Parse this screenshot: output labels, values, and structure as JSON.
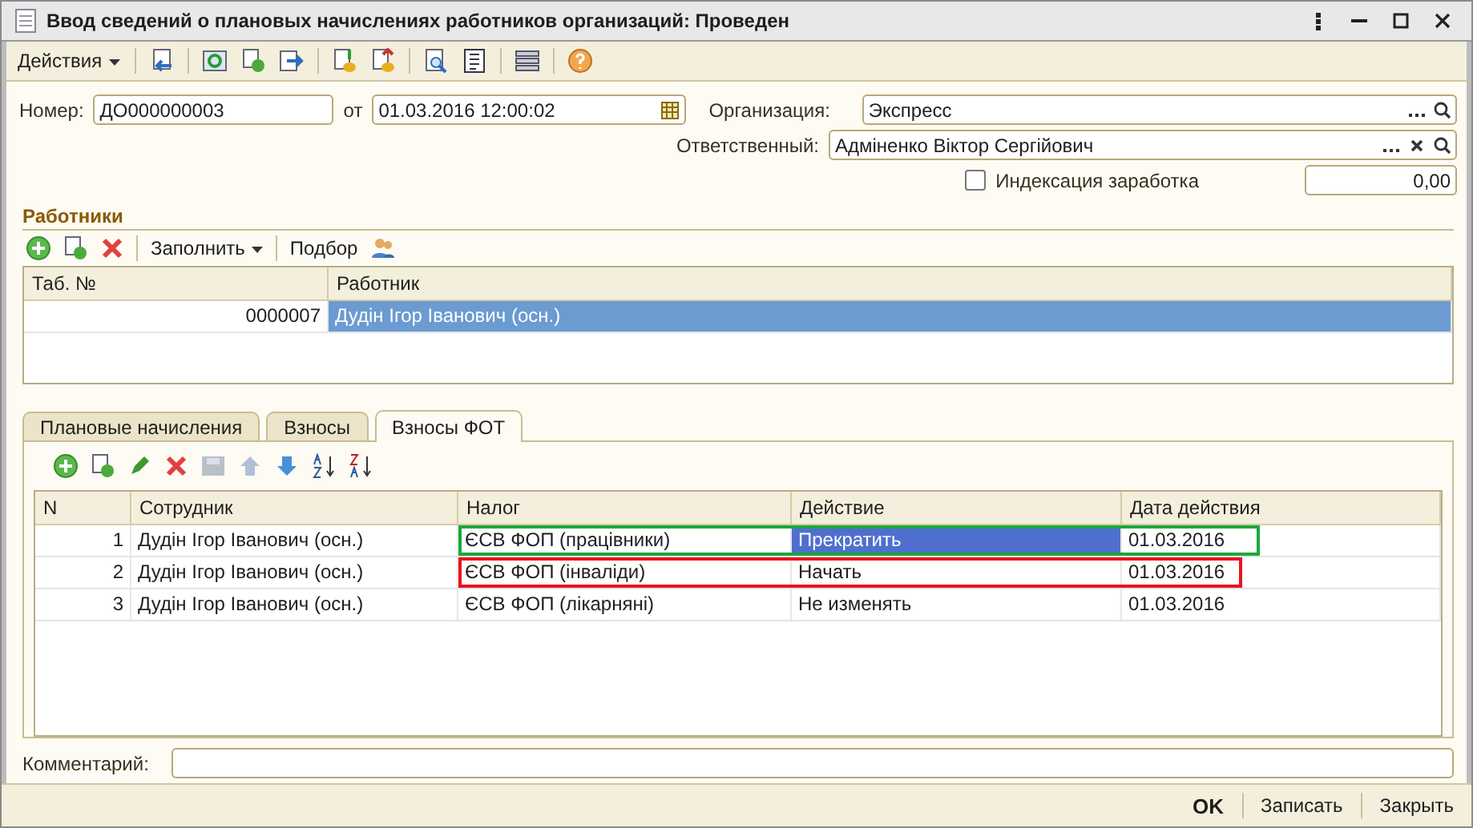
{
  "window": {
    "title": "Ввод сведений о плановых начислениях работников организаций: Проведен"
  },
  "toolbar": {
    "actions_menu": "Действия"
  },
  "header": {
    "number_label": "Номер:",
    "number": "ДО000000003",
    "date_label": "от",
    "date": "01.03.2016 12:00:02",
    "organization_label": "Организация:",
    "organization": "Экспресс",
    "responsible_label": "Ответственный:",
    "responsible": "Адміненко Віктор Сергійович",
    "indexation": {
      "label": "Индексация заработка",
      "checked": false
    },
    "indexation_amount": "0,00"
  },
  "employees": {
    "title": "Работники",
    "fill_button": "Заполнить",
    "pick_button": "Подбор",
    "columns": [
      "Таб. №",
      "Работник"
    ],
    "rows": [
      {
        "tab_no": "0000007",
        "employee": "Дудін Ігор Іванович (осн.)",
        "selected": true
      }
    ]
  },
  "tabs": [
    {
      "label": "Плановые начисления",
      "selected": false
    },
    {
      "label": "Взносы",
      "selected": false
    },
    {
      "label": "Взносы ФОТ",
      "selected": true
    }
  ],
  "contributions": {
    "columns": [
      "N",
      "Сотрудник",
      "Налог",
      "Действие",
      "Дата действия"
    ],
    "rows": [
      {
        "n": "1",
        "employee": "Дудін Ігор Іванович (осн.)",
        "tax": "ЄСВ ФОП (працівники)",
        "action": "Прекратить",
        "date": "01.03.2016",
        "selected": true,
        "color": "#1aa83a"
      },
      {
        "n": "2",
        "employee": "Дудін Ігор Іванович (осн.)",
        "tax": "ЄСВ ФОП (інваліди)",
        "action": "Начать",
        "date": "01.03.2016",
        "selected": false,
        "color": "#e8141e"
      },
      {
        "n": "3",
        "employee": "Дудін Ігор Іванович (осн.)",
        "tax": "ЄСВ ФОП (лікарняні)",
        "action": "Не изменять",
        "date": "01.03.2016",
        "selected": false
      }
    ]
  },
  "comment": {
    "label": "Комментарий:"
  },
  "footer": {
    "buttons": [
      "OK",
      "Записать",
      "Закрыть"
    ]
  }
}
